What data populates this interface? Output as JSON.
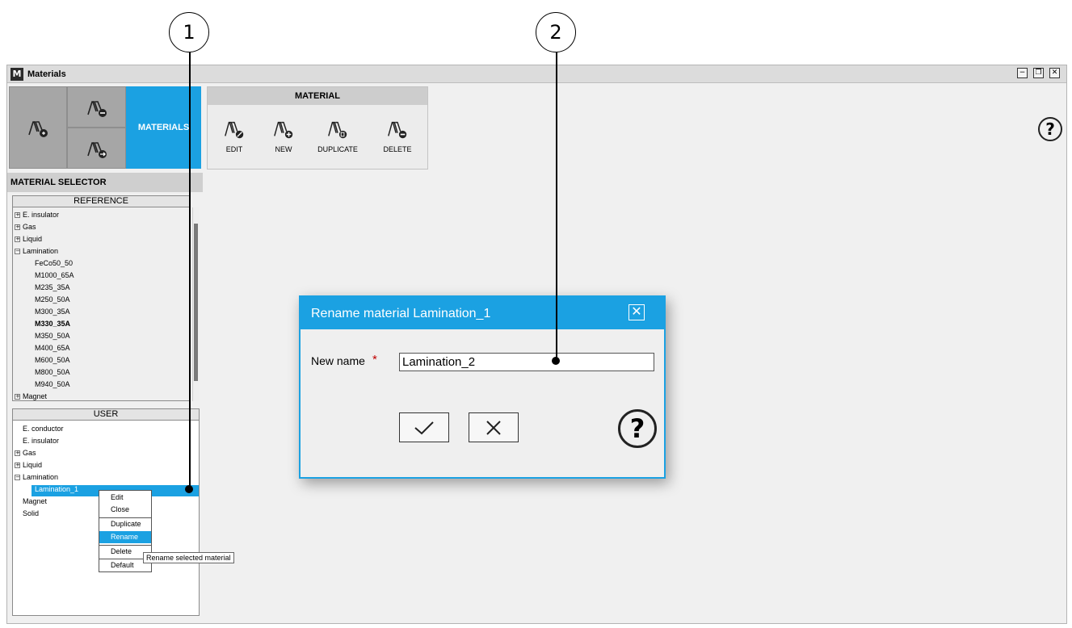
{
  "callouts": [
    "1",
    "2"
  ],
  "window": {
    "title": "Materials",
    "logo": "M",
    "controls": [
      "minimize-icon",
      "restore-icon",
      "close-icon"
    ]
  },
  "ribbon": {
    "materials_tab": "MATERIALS",
    "material_group": {
      "title": "MATERIAL",
      "buttons": [
        {
          "label": "EDIT",
          "icon": "material-edit-icon"
        },
        {
          "label": "NEW",
          "icon": "material-new-icon"
        },
        {
          "label": "DUPLICATE",
          "icon": "material-duplicate-icon"
        },
        {
          "label": "DELETE",
          "icon": "material-delete-icon"
        }
      ]
    }
  },
  "selector": {
    "title": "MATERIAL SELECTOR",
    "reference": {
      "header": "REFERENCE",
      "items": [
        {
          "label": "E. insulator",
          "level": 0,
          "expander": "+"
        },
        {
          "label": "Gas",
          "level": 0,
          "expander": "+"
        },
        {
          "label": "Liquid",
          "level": 0,
          "expander": "+"
        },
        {
          "label": "Lamination",
          "level": 0,
          "expander": "-"
        },
        {
          "label": "FeCo50_50",
          "level": 1
        },
        {
          "label": "M1000_65A",
          "level": 1
        },
        {
          "label": "M235_35A",
          "level": 1
        },
        {
          "label": "M250_50A",
          "level": 1
        },
        {
          "label": "M300_35A",
          "level": 1
        },
        {
          "label": "M330_35A",
          "level": 1,
          "bold": true
        },
        {
          "label": "M350_50A",
          "level": 1
        },
        {
          "label": "M400_65A",
          "level": 1
        },
        {
          "label": "M600_50A",
          "level": 1
        },
        {
          "label": "M800_50A",
          "level": 1
        },
        {
          "label": "M940_50A",
          "level": 1
        },
        {
          "label": "Magnet",
          "level": 0,
          "expander": "+"
        }
      ]
    },
    "user": {
      "header": "USER",
      "items": [
        {
          "label": "E. conductor",
          "level": 0
        },
        {
          "label": "E. insulator",
          "level": 0
        },
        {
          "label": "Gas",
          "level": 0,
          "expander": "+"
        },
        {
          "label": "Liquid",
          "level": 0,
          "expander": "+"
        },
        {
          "label": "Lamination",
          "level": 0,
          "expander": "-"
        },
        {
          "label": "Lamination_1",
          "level": 1,
          "selected": true
        },
        {
          "label": "Magnet",
          "level": 0
        },
        {
          "label": "Solid",
          "level": 0
        }
      ]
    }
  },
  "context_menu": {
    "items": [
      "Edit",
      "Close",
      "Duplicate",
      "Rename",
      "Delete",
      "Default"
    ],
    "active": "Rename",
    "tooltip": "Rename selected material"
  },
  "dialog": {
    "title": "Rename material Lamination_1",
    "field_label": "New name",
    "required_mark": "*",
    "field_value": "Lamination_2",
    "ok_icon": "check-icon",
    "cancel_icon": "x-icon",
    "help": "?"
  },
  "help_top": "?",
  "colors": {
    "accent": "#1ba1e2",
    "required": "#c00000",
    "ribbon_tile": "#a6a6a6"
  }
}
